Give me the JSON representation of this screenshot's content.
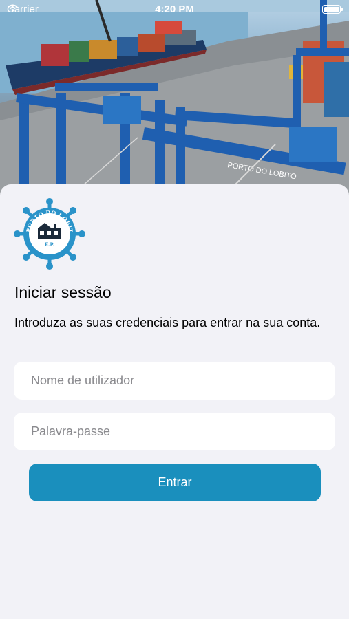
{
  "status_bar": {
    "carrier": "Carrier",
    "time": "4:20 PM",
    "wifi_icon": "wifi-icon",
    "battery_icon": "battery-icon"
  },
  "hero": {
    "image": "port-terminal-photo",
    "crane_text": "PORTO DO LOBITO"
  },
  "logo": {
    "name": "porto-do-lobito-logo",
    "text": "PORTO DO LOBITO",
    "subtext": "E.P."
  },
  "login": {
    "title": "Iniciar sessão",
    "subtitle": "Introduza as suas credenciais para entrar na sua conta.",
    "username": {
      "placeholder": "Nome de utilizador",
      "value": ""
    },
    "password": {
      "placeholder": "Palavra-passe",
      "value": ""
    },
    "submit_label": "Entrar"
  },
  "colors": {
    "accent": "#1a8fbd",
    "background": "#f2f2f7",
    "field": "#ffffff",
    "logo_blue": "#2a93c9"
  }
}
